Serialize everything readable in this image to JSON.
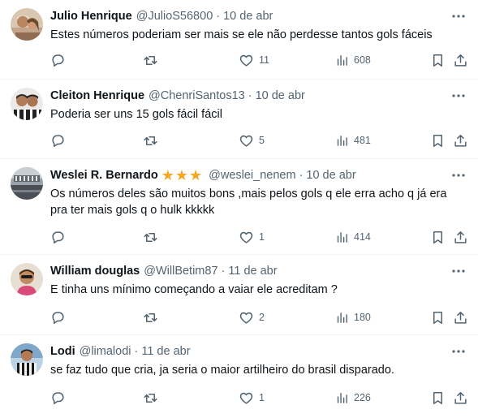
{
  "icons": {
    "reply": "reply-icon",
    "retweet": "retweet-icon",
    "like": "heart-icon",
    "views": "views-chart-icon",
    "bookmark": "bookmark-icon",
    "share": "share-icon",
    "more": "more-dots-icon"
  },
  "colors": {
    "text": "#0f1419",
    "secondary": "#536471",
    "divider": "#eff3f4",
    "star": "#f5a623"
  },
  "tweets": [
    {
      "name": "Julio Henrique",
      "handle": "@JulioS56800",
      "separator": "·",
      "date": "10 de abr",
      "text": "Estes números poderiam ser mais se ele não perdesse tantos gols fáceis",
      "likes": "11",
      "views": "608"
    },
    {
      "name": "Cleiton Henrique",
      "handle": "@ChenriSantos13",
      "separator": "·",
      "date": "10 de abr",
      "text": "Poderia ser uns 15 gols fácil fácil",
      "likes": "5",
      "views": "481"
    },
    {
      "name": "Weslei R. Bernardo",
      "handle": "@weslei_nenem",
      "separator": "·",
      "date": "10 de abr",
      "text": "Os números deles são muitos bons ,mais pelos gols q ele erra acho q já era pra ter mais gols q o hulk kkkkk",
      "likes": "1",
      "views": "414",
      "name_emoji": "star-emoji x3"
    },
    {
      "name": "William douglas",
      "handle": "@WillBetim87",
      "separator": "·",
      "date": "11 de abr",
      "text": "E tinha uns mínimo começando a vaiar ele acreditam ?",
      "likes": "2",
      "views": "180"
    },
    {
      "name": "Lodi",
      "handle": "@limalodi",
      "separator": "·",
      "date": "11 de abr",
      "text": "se faz tudo que cria, ja seria o maior artilheiro do brasil disparado.",
      "likes": "1",
      "views": "226"
    }
  ]
}
